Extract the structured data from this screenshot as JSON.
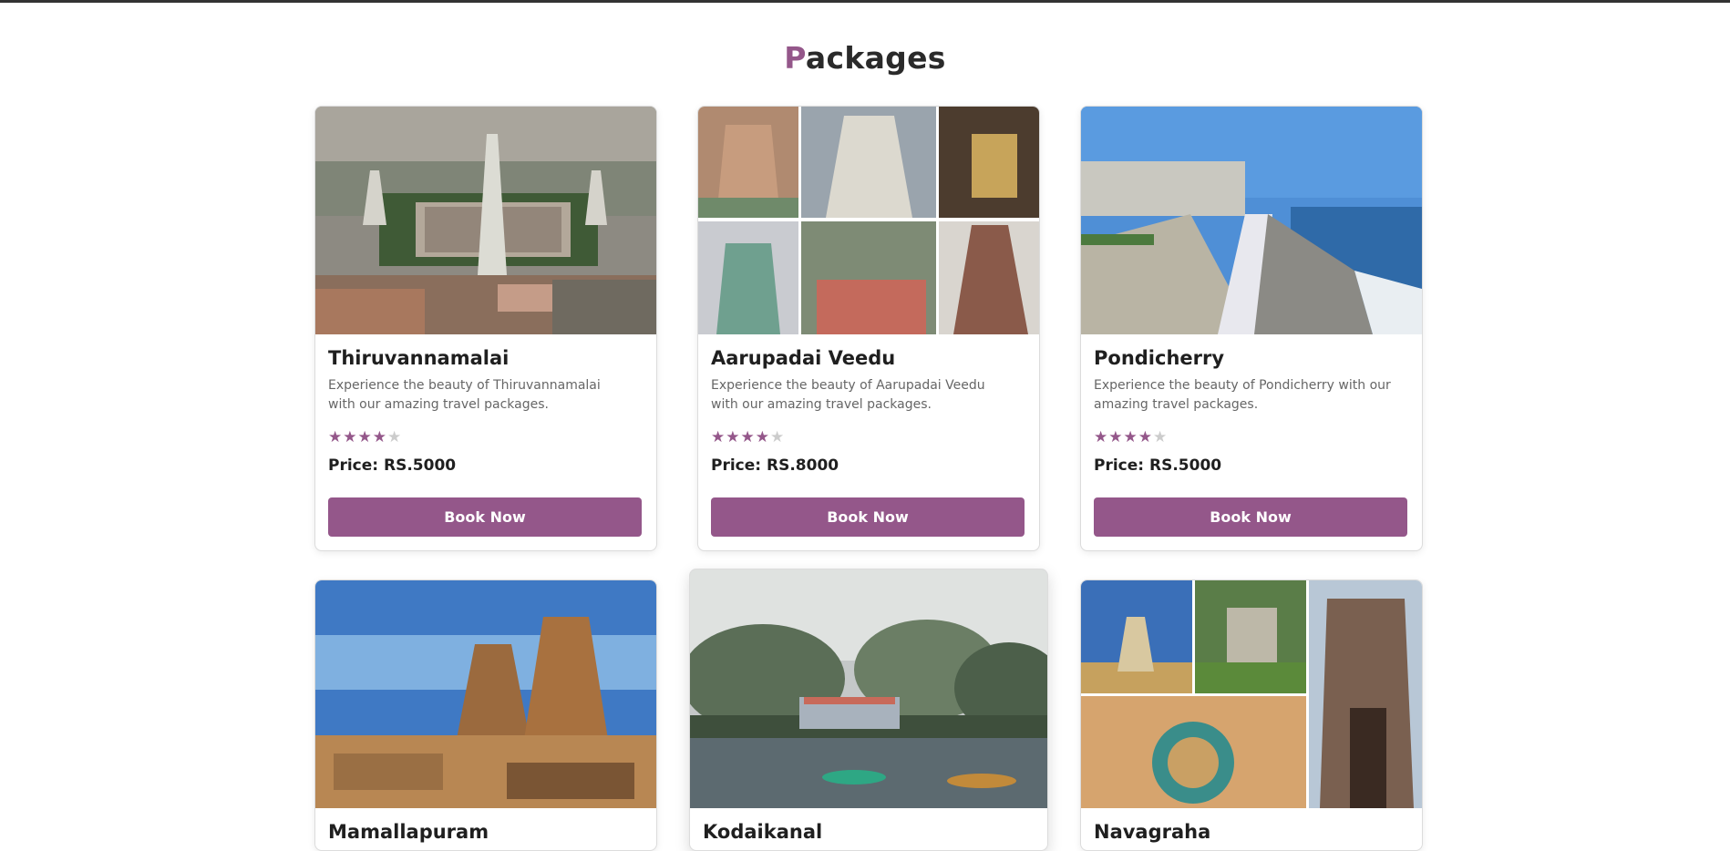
{
  "section": {
    "title_first": "P",
    "title_rest": "ackages"
  },
  "theme": {
    "accent": "#94578a",
    "text": "#1f1f1f",
    "muted": "#666666"
  },
  "packages": [
    {
      "name": "Thiruvannamalai",
      "description": "Experience the beauty of Thiruvannamalai with our amazing travel packages.",
      "rating": 4,
      "rating_max": 5,
      "price": "Price: RS.5000",
      "button": "Book Now",
      "image_icon": "temple-town-aerial-photo"
    },
    {
      "name": "Aarupadai Veedu",
      "description": "Experience the beauty of Aarupadai Veedu with our amazing travel packages.",
      "rating": 4,
      "rating_max": 5,
      "price": "Price: RS.8000",
      "button": "Book Now",
      "image_icon": "temple-collage-photo"
    },
    {
      "name": "Pondicherry",
      "description": "Experience the beauty of Pondicherry with our amazing travel packages.",
      "rating": 4,
      "rating_max": 5,
      "price": "Price: RS.5000",
      "button": "Book Now",
      "image_icon": "seaside-promenade-photo"
    },
    {
      "name": "Mamallapuram",
      "image_icon": "shore-temple-photo"
    },
    {
      "name": "Kodaikanal",
      "image_icon": "lake-boating-photo"
    },
    {
      "name": "Navagraha",
      "image_icon": "navagraha-temples-collage-photo"
    }
  ]
}
